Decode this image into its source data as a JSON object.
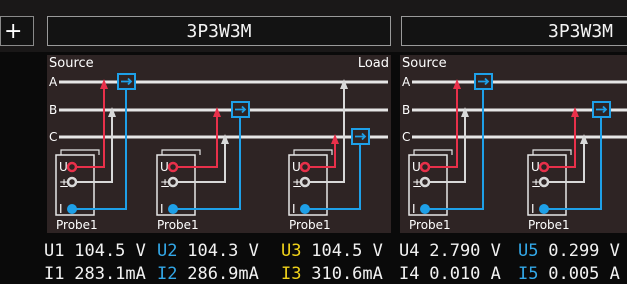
{
  "toolbar": {
    "plus_label": "+",
    "plus_icon": "plus-icon"
  },
  "titles": {
    "left": "3P3W3M",
    "right": "3P3W3M"
  },
  "diagram_left": {
    "source_label": "Source",
    "load_label": "Load",
    "lines": [
      "A",
      "B",
      "C"
    ],
    "probes": [
      "Probe1",
      "Probe1",
      "Probe1"
    ],
    "terminals": {
      "voltage_high": "U",
      "voltage_low": "±",
      "current": "I"
    }
  },
  "diagram_right": {
    "source_label": "Source",
    "lines": [
      "A",
      "B",
      "C"
    ],
    "probes": [
      "Probe1",
      "Probe1"
    ],
    "terminals": {
      "voltage_high": "U",
      "voltage_low": "±",
      "current": "I"
    }
  },
  "readings": {
    "u1": {
      "label": "U1",
      "value": " 104.5 V"
    },
    "u2": {
      "label": "U2",
      "value": " 104.3 V"
    },
    "u3": {
      "label": "U3",
      "value": " 104.5 V"
    },
    "u4": {
      "label": "U4",
      "value": " 2.790 V"
    },
    "u5": {
      "label": "U5",
      "value": " 0.299 V"
    },
    "i1": {
      "label": "I1",
      "value": " 283.1mA"
    },
    "i2": {
      "label": "I2",
      "value": " 286.9mA"
    },
    "i3": {
      "label": "I3",
      "value": " 310.6mA"
    },
    "i4": {
      "label": "I4",
      "value": " 0.010 A"
    },
    "i5": {
      "label": "I5",
      "value": " 0.005 A"
    }
  },
  "colors": {
    "voltage_high": "#e8304a",
    "voltage_low": "#d8d8d8",
    "current": "#1ea0e8",
    "channel_2": "#33a8e8",
    "channel_3": "#f0d21a",
    "panel_bg": "#2e2424"
  }
}
